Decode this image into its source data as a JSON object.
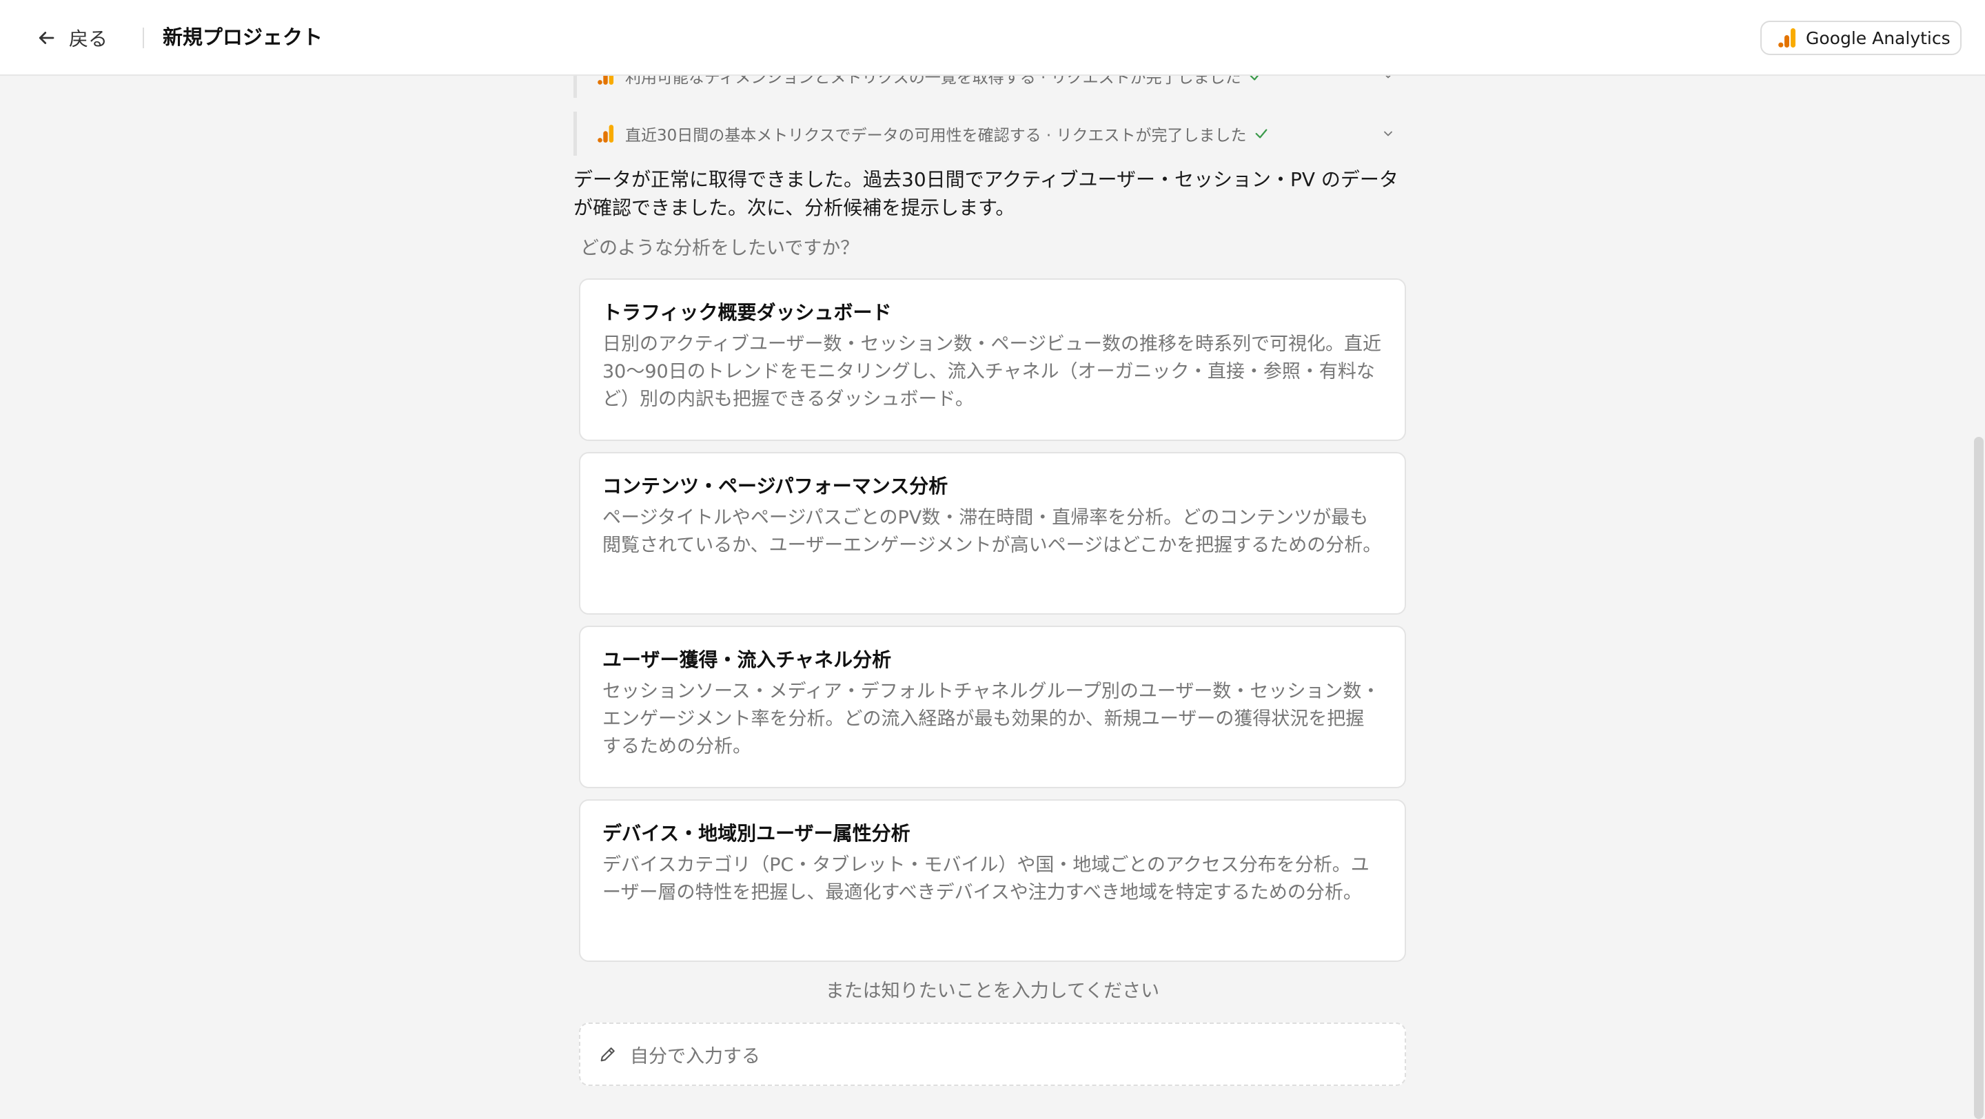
{
  "header": {
    "back_label": "戻る",
    "title": "新規プロジェクト",
    "ga_chip_label": "Google Analytics"
  },
  "tool_calls": [
    {
      "text": "利用可能なディメンションとメトリクスの一覧を取得する · リクエストが完了しました"
    },
    {
      "text": "直近30日間の基本メトリクスでデータの可用性を確認する · リクエストが完了しました"
    }
  ],
  "message": "データが正常に取得できました。過去30日間でアクティブユーザー・セッション・PV のデータが確認できました。次に、分析候補を提示します。",
  "question": "どのような分析をしたいですか？",
  "options": [
    {
      "title": "トラフィック概要ダッシュボード",
      "description": "日別のアクティブユーザー数・セッション数・ページビュー数の推移を時系列で可視化。直近30〜90日のトレンドをモニタリングし、流入チャネル（オーガニック・直接・参照・有料など）別の内訳も把握できるダッシュボード。"
    },
    {
      "title": "コンテンツ・ページパフォーマンス分析",
      "description": "ページタイトルやページパスごとのPV数・滞在時間・直帰率を分析。どのコンテンツが最も閲覧されているか、ユーザーエンゲージメントが高いページはどこかを把握するための分析。"
    },
    {
      "title": "ユーザー獲得・流入チャネル分析",
      "description": "セッションソース・メディア・デフォルトチャネルグループ別のユーザー数・セッション数・エンゲージメント率を分析。どの流入経路が最も効果的か、新規ユーザーの獲得状況を把握するための分析。"
    },
    {
      "title": "デバイス・地域別ユーザー属性分析",
      "description": "デバイスカテゴリ（PC・タブレット・モバイル）や国・地域ごとのアクセス分布を分析。ユーザー層の特性を把握し、最適化すべきデバイスや注力すべき地域を特定するための分析。"
    }
  ],
  "or_text": "または知りたいことを入力してください",
  "custom_input_label": "自分で入力する",
  "colors": {
    "ga_orange": "#F9AB00",
    "ga_dark_orange": "#E37400",
    "check_green": "#3a9a4a"
  },
  "icons": {
    "back": "arrow-left-icon",
    "analytics": "google-analytics-icon",
    "check": "check-icon",
    "chevron": "chevron-down-icon",
    "pencil": "pencil-icon"
  }
}
